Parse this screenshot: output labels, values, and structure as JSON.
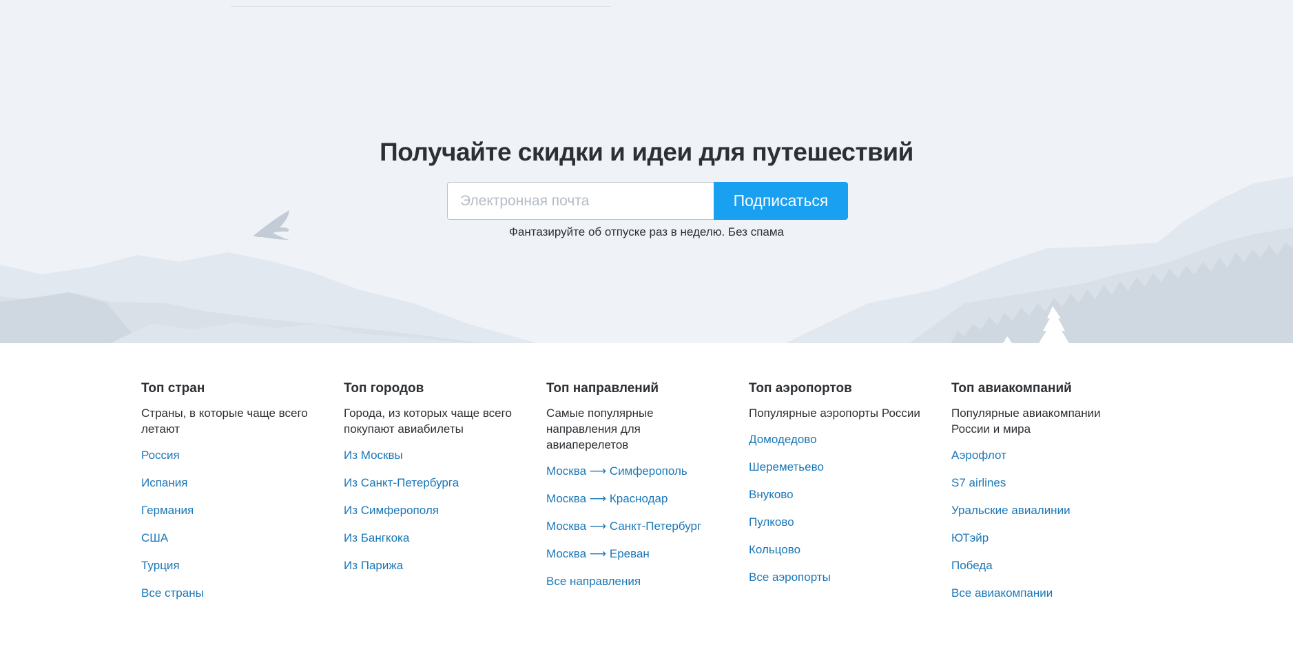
{
  "subscribe": {
    "title": "Получайте скидки и идеи для путешествий",
    "email_placeholder": "Электронная почта",
    "button_label": "Подписаться",
    "note": "Фантазируйте об отпуске раз в неделю. Без спама"
  },
  "colors": {
    "hero_background": "#eff3f8",
    "accent": "#1aa0f0",
    "link": "#1a77b8",
    "text": "#2c2f33"
  },
  "footer": {
    "columns": [
      {
        "title": "Топ стран",
        "description": "Страны, в которые чаще всего летают",
        "links": [
          "Россия",
          "Испания",
          "Германия",
          "США",
          "Турция",
          "Все страны"
        ]
      },
      {
        "title": "Топ городов",
        "description": "Города, из которых чаще всего покупают авиабилеты",
        "links": [
          "Из Москвы",
          "Из Санкт-Петербурга",
          "Из Симферополя",
          "Из Бангкока",
          "Из Парижа"
        ]
      },
      {
        "title": "Топ направлений",
        "description": "Самые популярные направления для авиаперелетов",
        "links": [
          "Москва ⟶ Симферополь",
          "Москва ⟶ Краснодар",
          "Москва ⟶ Санкт-Петербург",
          "Москва ⟶ Ереван",
          "Все направления"
        ]
      },
      {
        "title": "Топ аэропортов",
        "description": "Популярные аэропорты России",
        "links": [
          "Домодедово",
          "Шереметьево",
          "Внуково",
          "Пулково",
          "Кольцово",
          "Все аэропорты"
        ]
      },
      {
        "title": "Топ авиакомпаний",
        "description": "Популярные авиакомпании России и мира",
        "links": [
          "Аэрофлот",
          "S7 airlines",
          "Уральские авиалинии",
          "ЮТэйр",
          "Победа",
          "Все авиакомпании"
        ]
      }
    ]
  }
}
